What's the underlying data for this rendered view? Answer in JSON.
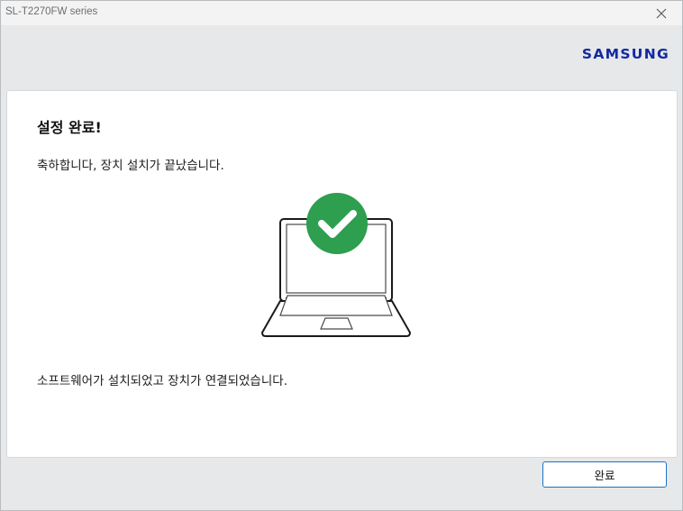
{
  "window": {
    "title": "SL-T2270FW series"
  },
  "header": {
    "logo": "SAMSUNG"
  },
  "content": {
    "heading": "설정 완료!",
    "congrats": "축하합니다, 장치 설치가 끝났습니다.",
    "message": "소프트웨어가 설치되었고 장치가 연결되었습니다."
  },
  "footer": {
    "finish_label": "완료"
  },
  "icons": {
    "close": "close-icon",
    "laptop": "laptop-icon",
    "check": "checkmark-icon"
  },
  "colors": {
    "brand": "#1428a0",
    "success": "#2e9e4f",
    "button_border": "#1a73c8"
  }
}
